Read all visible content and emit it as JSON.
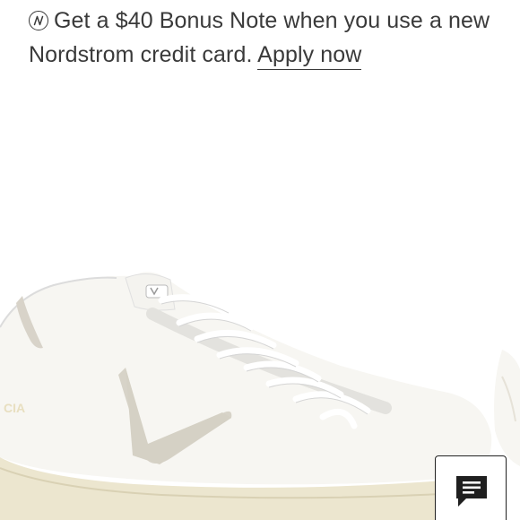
{
  "promo": {
    "line1": "Get a $40 Bonus Note when you use a new",
    "line2_text": "Nordstrom credit card.",
    "apply_link": "Apply now",
    "icon": "nordstrom-n-icon"
  },
  "product": {
    "image_icon": "sneaker-image"
  },
  "chat": {
    "icon": "chat-icon"
  }
}
